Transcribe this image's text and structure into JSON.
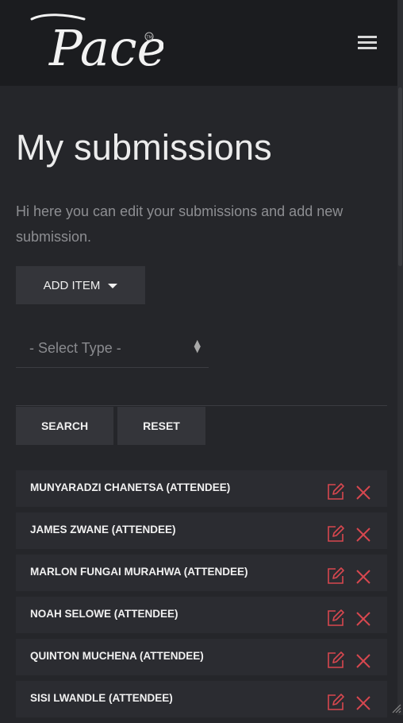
{
  "header": {
    "logo_text": "Pace",
    "trademark": "TM",
    "menu_icon": "hamburger-icon"
  },
  "page": {
    "title": "My submissions",
    "intro": "Hi here you can edit your submissions and add new submission."
  },
  "toolbar": {
    "add_item_label": "ADD ITEM",
    "select_placeholder": "- Select Type -",
    "search_label": "SEARCH",
    "reset_label": "RESET"
  },
  "submissions": [
    {
      "name": "MUNYARADZI CHANETSA (ATTENDEE)"
    },
    {
      "name": "JAMES ZWANE (ATTENDEE)"
    },
    {
      "name": "MARLON FUNGAI MURAHWA (ATTENDEE)"
    },
    {
      "name": "NOAH SELOWE (ATTENDEE)"
    },
    {
      "name": "QUINTON MUCHENA (ATTENDEE)"
    },
    {
      "name": "SISI LWANDLE (ATTENDEE)"
    }
  ],
  "colors": {
    "background": "#25262a",
    "header": "#1b1c1f",
    "button": "#34353a",
    "row": "#2b2c31",
    "accent_red": "#d7474f"
  }
}
